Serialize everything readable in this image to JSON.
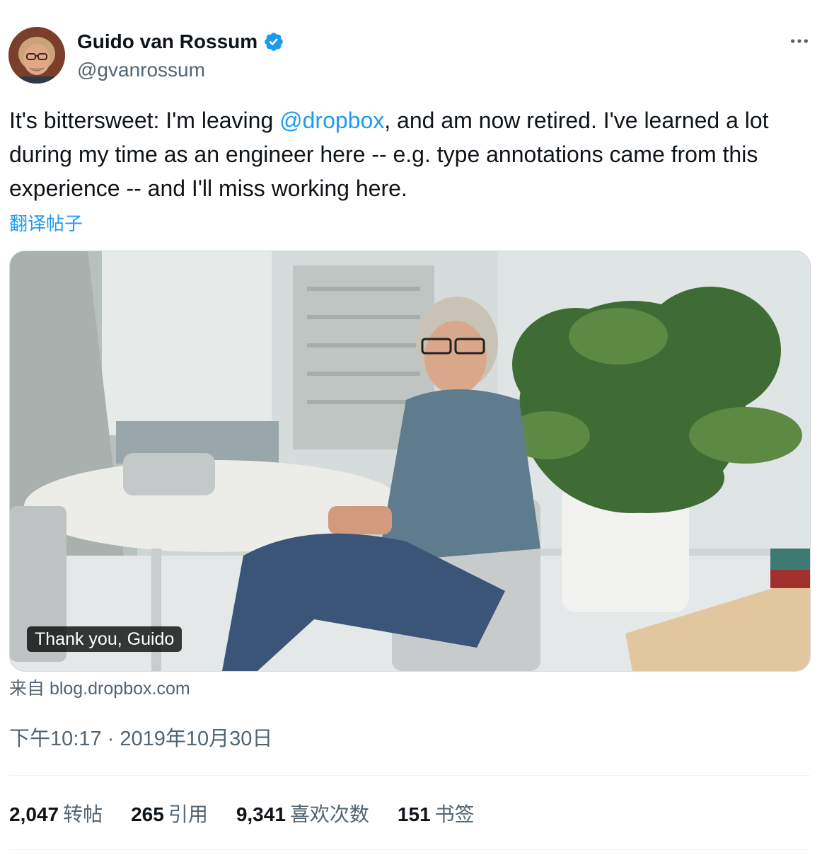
{
  "author": {
    "name": "Guido van Rossum",
    "handle": "@gvanrossum",
    "verified": true
  },
  "tweet": {
    "text_before": "It's bittersweet: I'm leaving ",
    "mention": "@dropbox",
    "text_after": ", and am now retired. I've learned a lot during my time as an engineer here -- e.g. type annotations came from this experience -- and I'll miss working here.",
    "translate_label": "翻译帖子"
  },
  "card": {
    "caption": "Thank you, Guido",
    "source_label": "来自 blog.dropbox.com"
  },
  "meta": {
    "timestamp": "下午10:17 · 2019年10月30日"
  },
  "stats": [
    {
      "count": "2,047",
      "label": "转帖"
    },
    {
      "count": "265",
      "label": "引用"
    },
    {
      "count": "9,341",
      "label": "喜欢次数"
    },
    {
      "count": "151",
      "label": "书签"
    }
  ],
  "icons": {
    "verified": "verified-badge-icon",
    "more": "more-horizontal-icon"
  },
  "colors": {
    "accent": "#1d9bf0",
    "text_primary": "#0f1419",
    "text_secondary": "#536471",
    "border": "#cfd9de"
  }
}
